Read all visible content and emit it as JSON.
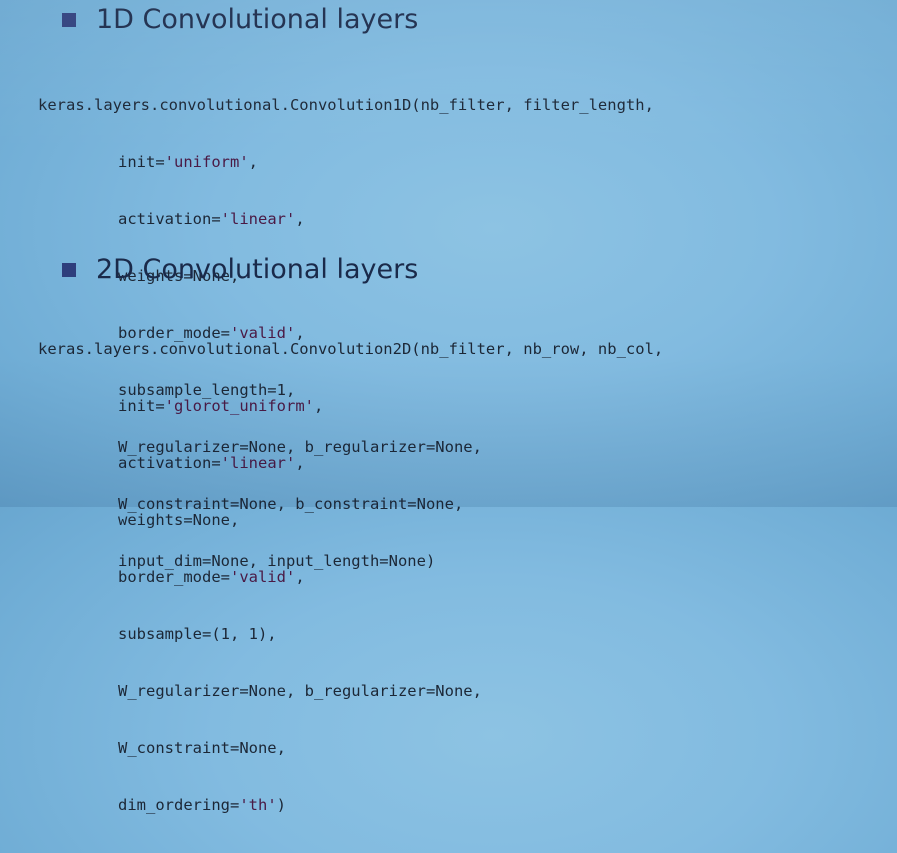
{
  "section1": {
    "heading": "1D Convolutional layers",
    "lines": [
      "keras.layers.convolutional.Convolution1D(nb_filter, filter_length,",
      "init='uniform',",
      "activation='linear',",
      "weights=None,",
      "border_mode='valid',",
      "subsample_length=1,",
      "W_regularizer=None, b_regularizer=None,",
      "W_constraint=None, b_constraint=None,",
      "input_dim=None, input_length=None)"
    ]
  },
  "section2": {
    "heading": "2D Convolutional layers",
    "lines": [
      "keras.layers.convolutional.Convolution2D(nb_filter, nb_row, nb_col,",
      "init='glorot_uniform',",
      "activation='linear',",
      "weights=None,",
      "border_mode='valid',",
      "subsample=(1, 1),",
      "W_regularizer=None, b_regularizer=None,",
      "W_constraint=None,",
      "dim_ordering='th')"
    ]
  },
  "colors": {
    "background": "#82bbe0",
    "bullet": "#2e3e7c",
    "text": "#1c2736",
    "string": "#4a1a45"
  }
}
